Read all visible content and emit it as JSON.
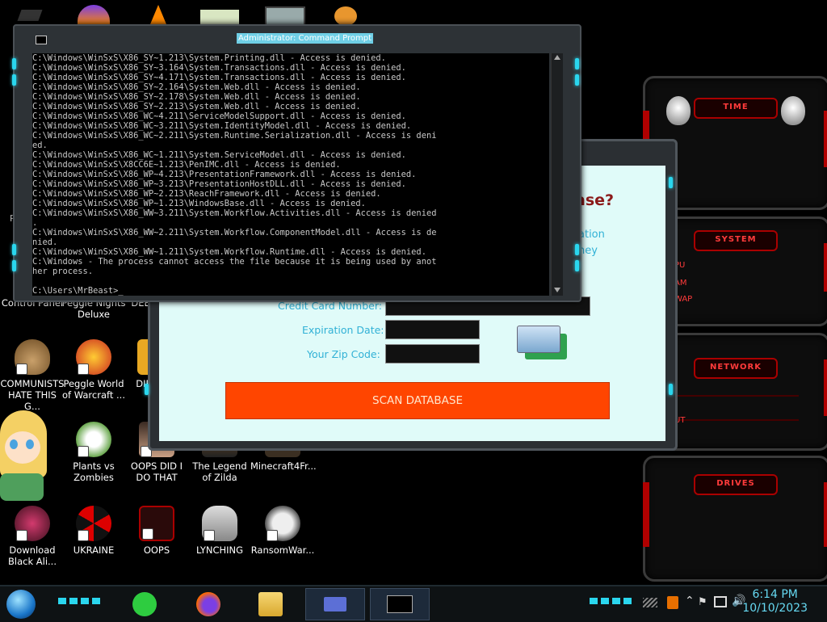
{
  "desktop": {
    "icons": [
      {
        "label": "Control Panel"
      },
      {
        "label": "Peggle Nights Deluxe"
      },
      {
        "label": "DEEZ"
      },
      {
        "label": "COMMUNISTS HATE THIS G..."
      },
      {
        "label": "Peggle World of Warcraft ..."
      },
      {
        "label": "DIE"
      },
      {
        "label": "Plants vs Zombies"
      },
      {
        "label": "OOPS DID I DO THAT"
      },
      {
        "label": "The Legend of Zilda"
      },
      {
        "label": "Minecraft4Fr..."
      },
      {
        "label": "Download Black Ali..."
      },
      {
        "label": "UKRAINE"
      },
      {
        "label": "OOPS"
      },
      {
        "label": "LYNCHING"
      },
      {
        "label": "RansomWar..."
      }
    ],
    "partial_labels": {
      "left_r": "Re",
      "left_n": "N"
    }
  },
  "gadgets": {
    "time": {
      "title": "TIME"
    },
    "system": {
      "title": "SYSTEM",
      "lines": [
        "PU",
        "AM",
        "WAP"
      ]
    },
    "network": {
      "title": "NETWORK",
      "line": "UT"
    },
    "drives": {
      "title": "DRIVES"
    }
  },
  "scam_dialog": {
    "heading_fragment": "ase?",
    "side_text_1": "ation",
    "side_text_2": "ney",
    "fields": {
      "credit_card_label": "Credit Card Number:",
      "expiration_label": "Expiration Date:",
      "zip_label": "Your Zip Code:"
    },
    "scan_button": "SCAN DATABASE"
  },
  "cmd": {
    "title": "Administrator: Command Prompt",
    "output": "C:\\Windows\\WinSxS\\X86_SY~1.213\\System.Printing.dll - Access is denied.\nC:\\Windows\\WinSxS\\X86_SY~3.164\\System.Transactions.dll - Access is denied.\nC:\\Windows\\WinSxS\\X86_SY~4.171\\System.Transactions.dll - Access is denied.\nC:\\Windows\\WinSxS\\X86_SY~2.164\\System.Web.dll - Access is denied.\nC:\\Windows\\WinSxS\\X86_SY~2.178\\System.Web.dll - Access is denied.\nC:\\Windows\\WinSxS\\X86_SY~2.213\\System.Web.dll - Access is denied.\nC:\\Windows\\WinSxS\\X86_WC~4.211\\ServiceModelSupport.dll - Access is denied.\nC:\\Windows\\WinSxS\\X86_WC~3.211\\System.IdentityModel.dll - Access is denied.\nC:\\Windows\\WinSxS\\X86_WC~2.211\\System.Runtime.Serialization.dll - Access is deni\ned.\nC:\\Windows\\WinSxS\\X86_WC~1.211\\System.ServiceModel.dll - Access is denied.\nC:\\Windows\\WinSxS\\X8CC6E~1.213\\PenIMC.dll - Access is denied.\nC:\\Windows\\WinSxS\\X86_WP~4.213\\PresentationFramework.dll - Access is denied.\nC:\\Windows\\WinSxS\\X86_WP~3.213\\PresentationHostDLL.dll - Access is denied.\nC:\\Windows\\WinSxS\\X86_WP~2.213\\ReachFramework.dll - Access is denied.\nC:\\Windows\\WinSxS\\X86_WP~1.213\\WindowsBase.dll - Access is denied.\nC:\\Windows\\WinSxS\\X86_WW~3.211\\System.Workflow.Activities.dll - Access is denied\n.\nC:\\Windows\\WinSxS\\X86_WW~2.211\\System.Workflow.ComponentModel.dll - Access is de\nnied.\nC:\\Windows\\WinSxS\\X86_WW~1.211\\System.Workflow.Runtime.dll - Access is denied.\nC:\\Windows - The process cannot access the file because it is being used by anot\nher process.\n\nC:\\Users\\MrBeast>_"
  },
  "taskbar": {
    "clock_time": "6:14 PM",
    "clock_date": "10/10/2023"
  },
  "colors": {
    "accent_cyan": "#2ad6ee",
    "scan_button": "#ff4500",
    "alien_red": "#b00000"
  }
}
